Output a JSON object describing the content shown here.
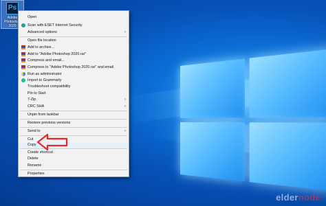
{
  "desktop_icon": {
    "app_tile": "Ps",
    "label": "Adobe Photoshop 2020"
  },
  "menu": {
    "items": [
      {
        "label": "Open",
        "icon": "",
        "submenu": false
      },
      {
        "label": "Scan with ESET Internet Security",
        "icon": "eset-icon",
        "submenu": false
      },
      {
        "label": "Advanced options",
        "icon": "",
        "submenu": true
      },
      {
        "label": "Open file location",
        "icon": "",
        "submenu": false
      },
      {
        "label": "Add to archive...",
        "icon": "winrar-icon",
        "submenu": false
      },
      {
        "label": "Add to \"Adobe Photoshop 2020.rar\"",
        "icon": "winrar-icon",
        "submenu": false
      },
      {
        "label": "Compress and email...",
        "icon": "winrar-icon",
        "submenu": false
      },
      {
        "label": "Compress to \"Adobe Photoshop 2020.rar\" and email",
        "icon": "winrar-icon",
        "submenu": false
      },
      {
        "label": "Run as administrator",
        "icon": "uac-shield-icon",
        "submenu": false
      },
      {
        "label": "Import to Grammarly",
        "icon": "grammarly-icon",
        "submenu": false
      },
      {
        "label": "Troubleshoot compatibility",
        "icon": "",
        "submenu": false
      },
      {
        "label": "Pin to Start",
        "icon": "",
        "submenu": false
      },
      {
        "label": "7-Zip",
        "icon": "",
        "submenu": true
      },
      {
        "label": "CRC SHA",
        "icon": "",
        "submenu": true
      },
      {
        "label": "Unpin from taskbar",
        "icon": "",
        "submenu": false
      },
      {
        "label": "Restore previous versions",
        "icon": "",
        "submenu": false
      },
      {
        "label": "Send to",
        "icon": "",
        "submenu": true
      },
      {
        "label": "Cut",
        "icon": "",
        "submenu": false
      },
      {
        "label": "Copy",
        "icon": "",
        "submenu": false
      },
      {
        "label": "Create shortcut",
        "icon": "",
        "submenu": false
      },
      {
        "label": "Delete",
        "icon": "",
        "submenu": false
      },
      {
        "label": "Rename",
        "icon": "",
        "submenu": false
      },
      {
        "label": "Properties",
        "icon": "",
        "submenu": false
      }
    ],
    "submenu_arrow": "›",
    "highlighted_item": "Copy"
  },
  "annotation": {
    "arrow_color": "#e8262c",
    "points_to": "Copy"
  },
  "watermark": {
    "text_main": "eldernode",
    "text_accent": "node"
  },
  "colors": {
    "desktop_blue": "#0651b8",
    "menu_bg": "#f2f2f2",
    "accent_red": "#e8262c"
  }
}
